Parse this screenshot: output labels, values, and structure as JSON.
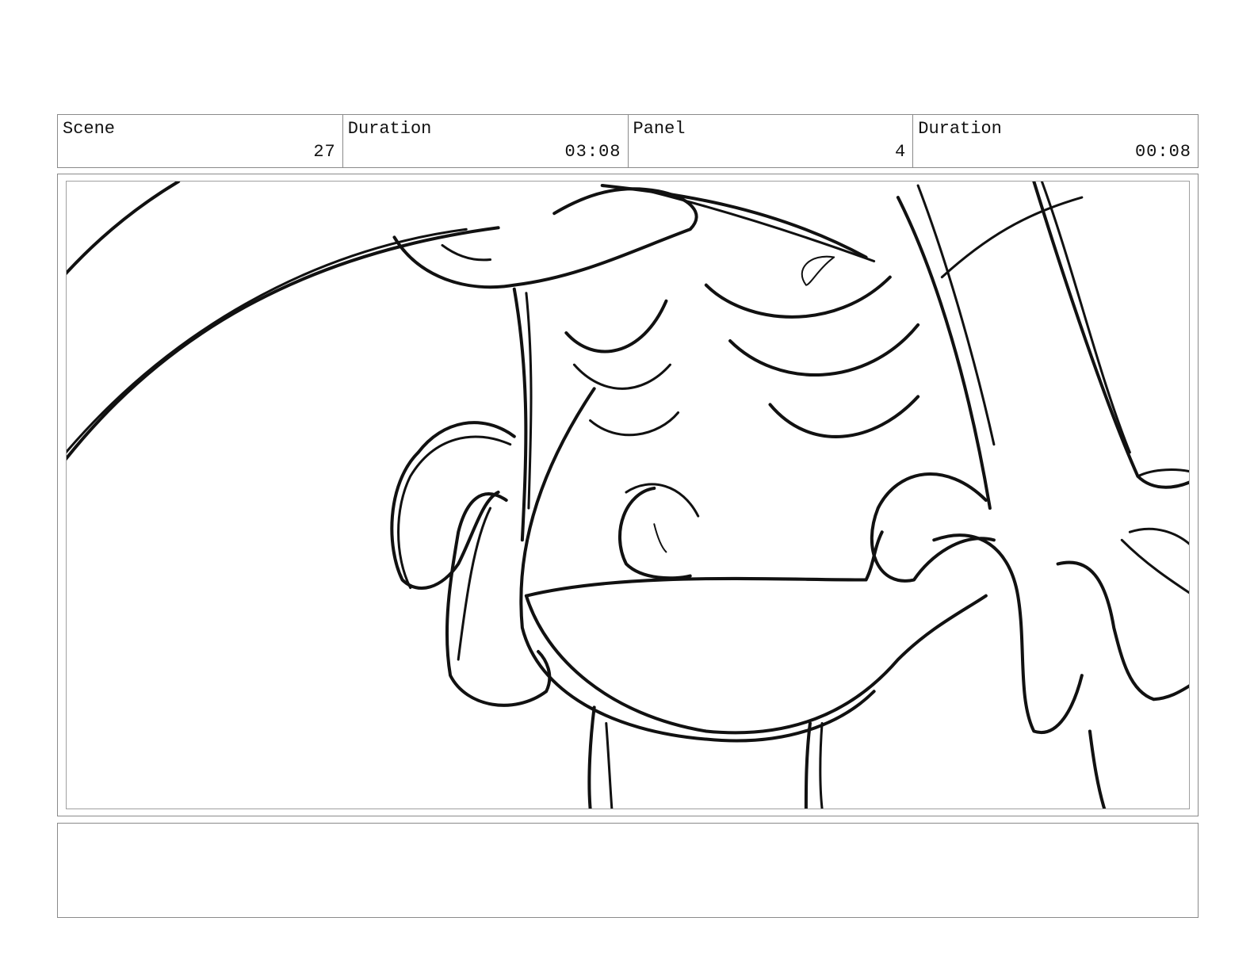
{
  "header": {
    "scene": {
      "label": "Scene",
      "value": "27"
    },
    "scene_duration": {
      "label": "Duration",
      "value": "03:08"
    },
    "panel": {
      "label": "Panel",
      "value": "4"
    },
    "panel_duration": {
      "label": "Duration",
      "value": "00:08"
    }
  },
  "notes": {
    "text": ""
  },
  "colors": {
    "ink": "#111111",
    "border": "#8a8a8a",
    "paper": "#ffffff"
  }
}
